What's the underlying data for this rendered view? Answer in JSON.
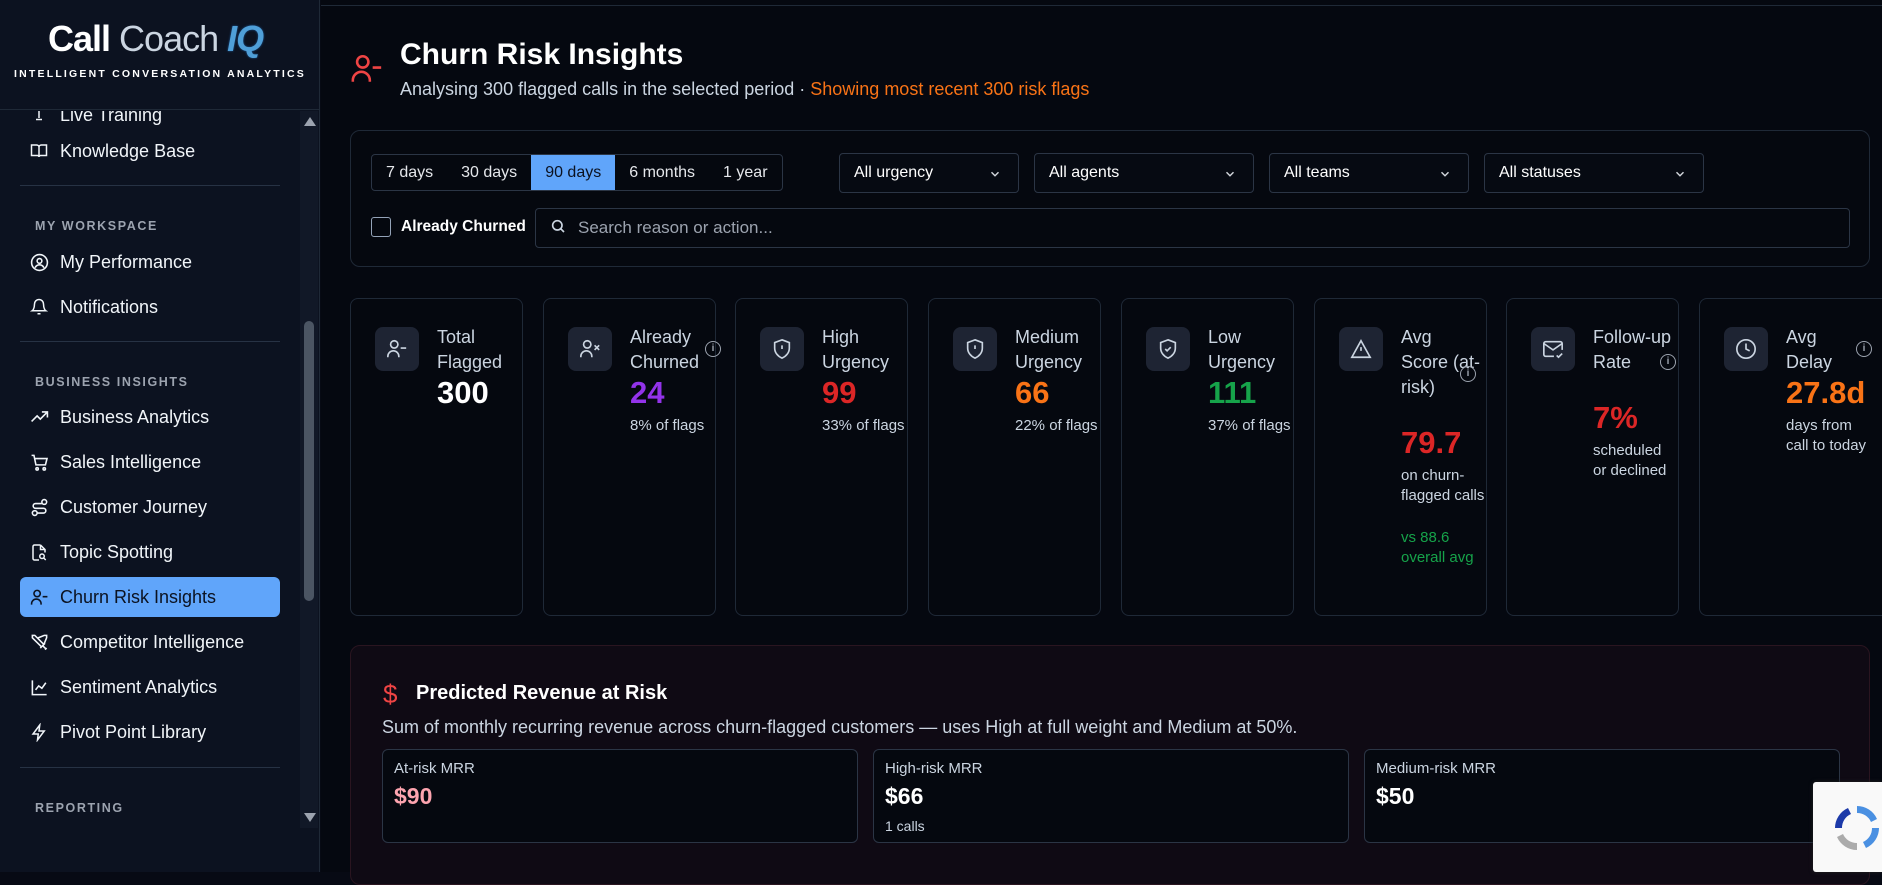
{
  "brand": {
    "call": "Call",
    "coach": "Coach",
    "iq": "IQ",
    "tagline": "INTELLIGENT CONVERSATION ANALYTICS"
  },
  "sidebar": {
    "partial_item": "Live Training",
    "knowledge_base": "Knowledge Base",
    "sections": {
      "workspace": "MY WORKSPACE",
      "business": "BUSINESS INSIGHTS",
      "reporting": "REPORTING"
    },
    "workspace_items": [
      "My Performance",
      "Notifications"
    ],
    "business_items": [
      "Business Analytics",
      "Sales Intelligence",
      "Customer Journey",
      "Topic Spotting",
      "Churn Risk Insights",
      "Competitor Intelligence",
      "Sentiment Analytics",
      "Pivot Point Library"
    ],
    "active_item": "Churn Risk Insights"
  },
  "header": {
    "title": "Churn Risk Insights",
    "subtitle": "Analysing 300 flagged calls in the selected period · ",
    "subtitle_warn": "Showing most recent 300 risk flags"
  },
  "filters": {
    "ranges": [
      "7 days",
      "30 days",
      "90 days",
      "6 months",
      "1 year"
    ],
    "selected_range": "90 days",
    "urgency": "All urgency",
    "agents": "All agents",
    "teams": "All teams",
    "statuses": "All statuses",
    "already_churned_label": "Already Churned",
    "already_churned_checked": false,
    "search_placeholder": "Search reason or action..."
  },
  "stats": [
    {
      "label": "Total Flagged",
      "value": "300",
      "color": "#ffffff",
      "note": ""
    },
    {
      "label": "Already Churned",
      "value": "24",
      "color": "#9333ea",
      "note": "8% of flags"
    },
    {
      "label": "High Urgency",
      "value": "99",
      "color": "#dc2626",
      "note": "33% of flags"
    },
    {
      "label": "Medium Urgency",
      "value": "66",
      "color": "#f97316",
      "note": "22% of flags"
    },
    {
      "label": "Low Urgency",
      "value": "111",
      "color": "#16a34a",
      "note": "37% of flags"
    },
    {
      "label": "Avg Score (at-risk)",
      "value": "79.7",
      "color": "#dc2626",
      "note": "on churn-flagged calls",
      "extra": "vs 88.6 overall avg",
      "extra_color": "#16a34a"
    },
    {
      "label": "Follow-up Rate",
      "value": "7%",
      "color": "#dc2626",
      "note": "scheduled or declined"
    },
    {
      "label": "Avg Delay",
      "value": "27.8d",
      "color": "#f97316",
      "note": "days from call to today"
    }
  ],
  "revenue": {
    "icon": "$",
    "title": "Predicted Revenue at Risk",
    "description": "Sum of monthly recurring revenue across churn-flagged customers — uses High at full weight and Medium at 50%.",
    "at_risk": {
      "label": "At-risk MRR",
      "value": "$90",
      "color": "#fda4af"
    },
    "high_risk": {
      "label": "High-risk MRR",
      "value": "$66",
      "sub": "1 calls"
    },
    "medium_risk": {
      "label": "Medium-risk MRR",
      "value": "$50"
    }
  }
}
